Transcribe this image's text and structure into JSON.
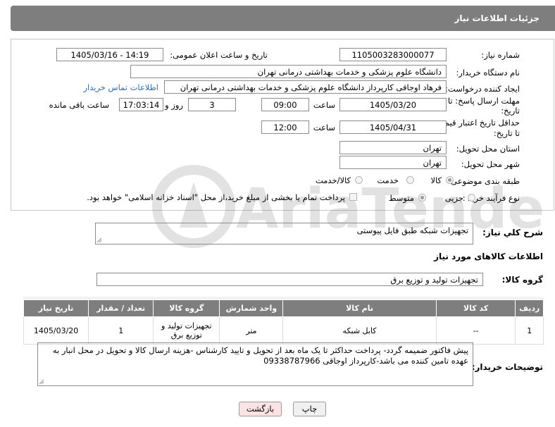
{
  "header": {
    "title": "جزئیات اطلاعات نیاز"
  },
  "form": {
    "need_number_label": "شماره نیاز:",
    "need_number": "1105003283000077",
    "announce_label": "تاریخ و ساعت اعلان عمومی:",
    "announce_value": "1405/03/16 - 14:19",
    "buyer_org_label": "نام دستگاه خریدار:",
    "buyer_org": "دانشگاه علوم پزشکی و خدمات بهداشتی درمانی تهران",
    "creator_label": "ایجاد کننده درخواست:",
    "creator": "فرهاد اوجاقی کارپرداز دانشگاه علوم پزشکی و خدمات بهداشتی درمانی تهران",
    "contact_link": "اطلاعات تماس خریدار",
    "reply_deadline_label_1": "مهلت ارسال پاسخ: تا",
    "reply_deadline_label_2": "تاریخ:",
    "reply_date": "1405/03/20",
    "time_label": "ساعت",
    "reply_time": "09:00",
    "days_value": "3",
    "days_label": "روز و",
    "remaining_time": "17:03:14",
    "remaining_label": "ساعت باقی مانده",
    "price_deadline_label_1": "حداقل تاریخ اعتبار قیمت:",
    "price_deadline_label_2": "تا تاریخ:",
    "price_date": "1405/04/31",
    "price_time": "12:00",
    "province_label": "استان محل تحویل:",
    "province": "تهران",
    "city_label": "شهر محل تحویل:",
    "city": "تهران",
    "category_label": "طبقه بندی موضوعی:",
    "category_options": [
      "کالا",
      "خدمت",
      "کالا/خدمت"
    ],
    "category_selected": "کالا",
    "process_label": "نوع فرآیند خرید :",
    "process_options": [
      "جزیی",
      "متوسط"
    ],
    "process_selected": "متوسط",
    "payment_note": "پرداخت تمام یا بخشی از مبلغ خرید،از محل \"اسناد خزانه اسلامی\" خواهد بود."
  },
  "description": {
    "label": "شرح کلي نياز:",
    "value": "تجهیزات شبکه طبق فایل پیوستی"
  },
  "goods_section": {
    "title": "اطلاعات کالاهای مورد نیاز",
    "group_label": "گروه کالا:",
    "group_value": "تجهیزات تولید و توزیع برق"
  },
  "table": {
    "headers": [
      "ردیف",
      "کد کالا",
      "نام کالا",
      "واحد شمارش",
      "گروه کالا",
      "تعداد / مقدار",
      "تاریخ نیاز"
    ],
    "rows": [
      {
        "row": "1",
        "code": "--",
        "name": "کابل شبکه",
        "unit": "متر",
        "group": "تجهیزات تولید و توزیع برق",
        "qty": "1",
        "date": "1405/03/20"
      }
    ]
  },
  "buyer_notes": {
    "label": "توضیحات خریدار:",
    "value": "پیش فاکتور ضمیمه گردد- پرداخت حداکثر تا یک ماه بعد از تحویل و تایید کارشناس -هزینه ارسال کالا و تحویل در محل انبار به عهده تامین کننده می باشد-کارپرداز اوجاقی 09338787966"
  },
  "buttons": {
    "print": "چاپ",
    "back": "بازگشت"
  },
  "watermark": {
    "text": "AriaTender.net"
  },
  "colors": {
    "header_bg": "#7e7e7e",
    "link": "#2a6db5",
    "print_btn": "#f0f0f0",
    "back_btn": "#fbe3e3"
  }
}
